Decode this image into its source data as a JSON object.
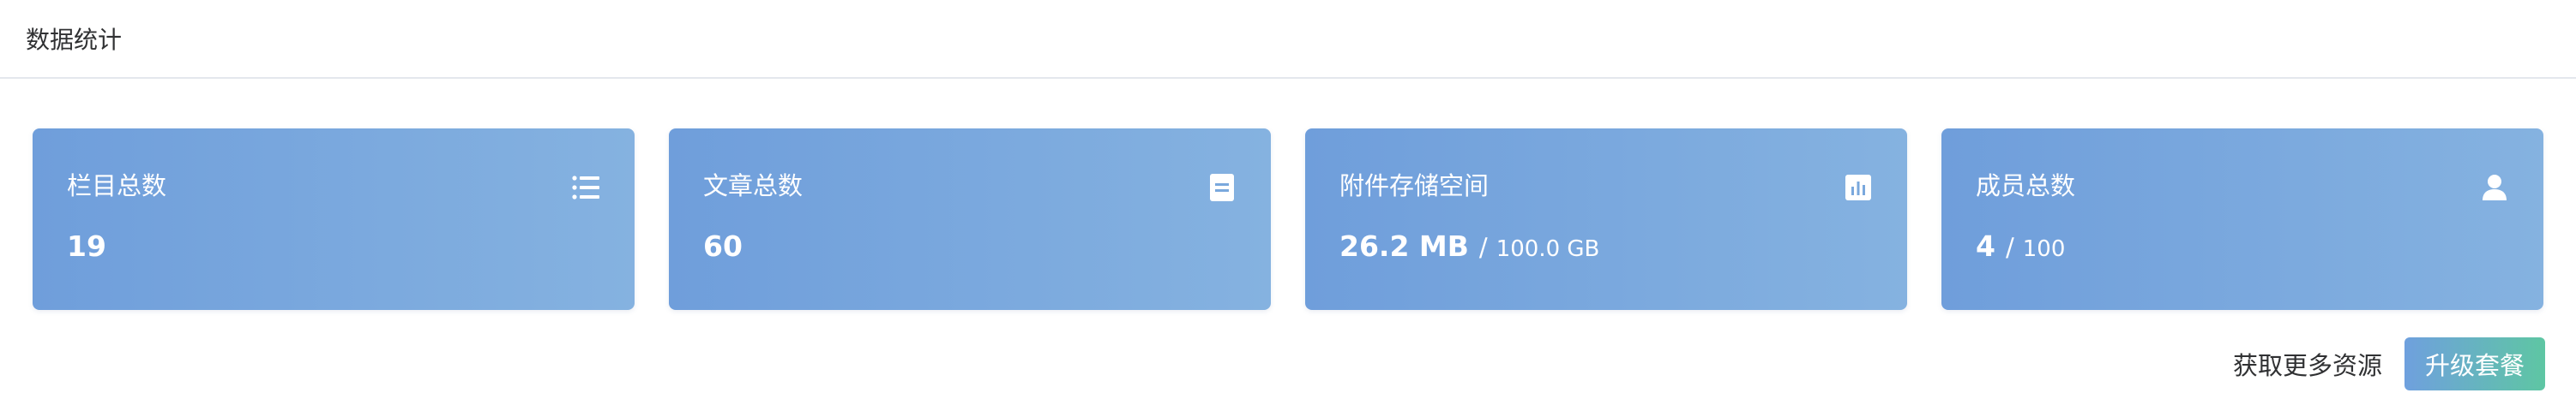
{
  "header": {
    "title": "数据统计"
  },
  "cards": [
    {
      "title": "栏目总数",
      "value": "19",
      "icon": "list-icon"
    },
    {
      "title": "文章总数",
      "value": "60",
      "icon": "document-icon"
    },
    {
      "title": "附件存储空间",
      "value": "26.2 MB",
      "separator": "/",
      "total": "100.0 GB",
      "icon": "bar-chart-icon"
    },
    {
      "title": "成员总数",
      "value": "4",
      "separator": "/",
      "total": "100",
      "icon": "user-icon"
    }
  ],
  "footer": {
    "more_resources_text": "获取更多资源",
    "upgrade_label": "升级套餐"
  },
  "colors": {
    "card_gradient_start": "#6f9edb",
    "card_gradient_end": "#85b2e0",
    "button_gradient_start": "#6fa0de",
    "button_gradient_end": "#5ec6a3"
  }
}
